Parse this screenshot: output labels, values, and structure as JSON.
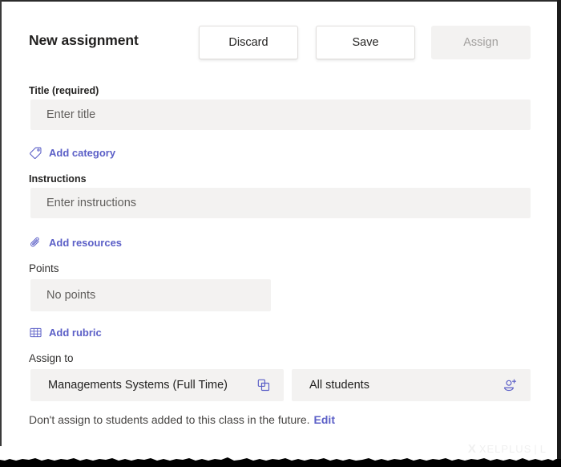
{
  "header": {
    "title": "New assignment",
    "buttons": [
      {
        "label": "Discard",
        "name": "discard-button",
        "state": "enabled"
      },
      {
        "label": "Save",
        "name": "save-button",
        "state": "enabled"
      },
      {
        "label": "Assign",
        "name": "assign-button",
        "state": "disabled"
      }
    ]
  },
  "form": {
    "title_field": {
      "label": "Title (required)",
      "placeholder": "Enter title",
      "value": ""
    },
    "add_category": {
      "label": "Add category",
      "icon": "tag-icon"
    },
    "instructions_field": {
      "label": "Instructions",
      "placeholder": "Enter instructions",
      "value": ""
    },
    "add_resources": {
      "label": "Add resources",
      "icon": "paperclip-icon"
    },
    "points_field": {
      "label": "Points",
      "placeholder": "No points",
      "value": ""
    },
    "add_rubric": {
      "label": "Add rubric",
      "icon": "grid-icon"
    },
    "assign_to": {
      "label": "Assign to",
      "class_selector": {
        "value": "Managements Systems (Full Time)",
        "icon": "copy-icon"
      },
      "students_selector": {
        "value": "All students",
        "icon": "person-add-icon"
      }
    },
    "footnote": {
      "text": "Don't assign to students added to this class in the future.",
      "edit_label": "Edit"
    }
  },
  "watermark": {
    "mark": "X",
    "name": "XELPLUS",
    "separator": "|",
    "suffix": "L"
  },
  "colors": {
    "accent": "#5b5fc7",
    "field_bg": "#f3f2f1",
    "text": "#252423",
    "placeholder": "#605e5c",
    "disabled_text": "#a19f9d"
  }
}
